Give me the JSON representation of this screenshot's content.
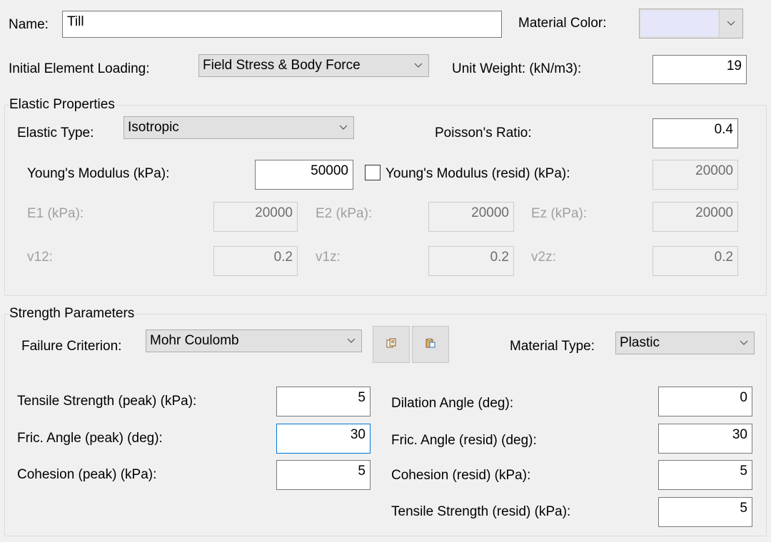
{
  "name": {
    "label": "Name:",
    "value": "Till"
  },
  "material_color": {
    "label": "Material Color:",
    "swatch": "#e6e6fa"
  },
  "loading": {
    "label": "Initial Element Loading:",
    "value": "Field Stress & Body Force"
  },
  "unit_weight": {
    "label": "Unit Weight: (kN/m3):",
    "value": "19"
  },
  "elastic": {
    "title": "Elastic Properties",
    "type_label": "Elastic Type:",
    "type_value": "Isotropic",
    "poisson_label": "Poisson's Ratio:",
    "poisson_value": "0.4",
    "youngs_label": "Young's Modulus (kPa):",
    "youngs_value": "50000",
    "youngs_resid_label": "Young's Modulus (resid) (kPa):",
    "youngs_resid_value": "20000",
    "e1_label": "E1 (kPa):",
    "e1_value": "20000",
    "e2_label": "E2 (kPa):",
    "e2_value": "20000",
    "ez_label": "Ez (kPa):",
    "ez_value": "20000",
    "v12_label": "v12:",
    "v12_value": "0.2",
    "v1z_label": "v1z:",
    "v1z_value": "0.2",
    "v2z_label": "v2z:",
    "v2z_value": "0.2"
  },
  "strength": {
    "title": "Strength Parameters",
    "criterion_label": "Failure Criterion:",
    "criterion_value": "Mohr Coulomb",
    "material_type_label": "Material Type:",
    "material_type_value": "Plastic",
    "tensile_peak_label": "Tensile Strength (peak) (kPa):",
    "tensile_peak_value": "5",
    "fric_peak_label": "Fric. Angle (peak) (deg):",
    "fric_peak_value": "30",
    "cohesion_peak_label": "Cohesion (peak) (kPa):",
    "cohesion_peak_value": "5",
    "dilation_label": "Dilation Angle (deg):",
    "dilation_value": "0",
    "fric_resid_label": "Fric. Angle (resid) (deg):",
    "fric_resid_value": "30",
    "cohesion_resid_label": "Cohesion (resid) (kPa):",
    "cohesion_resid_value": "5",
    "tensile_resid_label": "Tensile Strength (resid) (kPa):",
    "tensile_resid_value": "5"
  },
  "icons": {
    "copy": "copy-icon",
    "paste": "paste-icon",
    "dropdown": "chevron-down-icon"
  }
}
